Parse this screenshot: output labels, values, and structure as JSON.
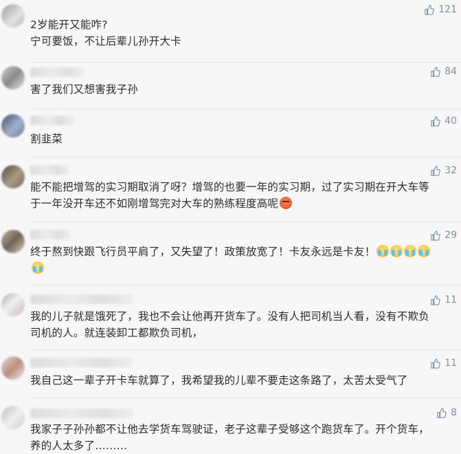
{
  "comments": [
    {
      "likes": "121",
      "lines": [
        "2岁能开又能咋?",
        "宁可要饭，不让后辈儿孙开大卡"
      ]
    },
    {
      "likes": "84",
      "lines": [
        "害了我们又想害我子孙"
      ]
    },
    {
      "likes": "40",
      "lines": [
        "割韭菜"
      ]
    },
    {
      "likes": "32",
      "lines": [
        "能不能把增驾的实习期取消了呀？增驾的也要一年的实习期，过了实习期在开大车等",
        "于一年没开车还不如刚增驾完对大车的熟练程度高呢"
      ],
      "emoji_after": "angry-face-icon"
    },
    {
      "likes": "29",
      "lines": [
        "终于熬到快跟飞行员平肩了，又失望了！政策放宽了！卡友永远是卡友！"
      ],
      "emoji_after": "crying-face-icon"
    },
    {
      "likes": "11",
      "lines": [
        "我的儿子就是饿死了，我也不会让他再开货车了。没有人把司机当人看，没有不欺负",
        "司机的人。就连装卸工都欺负司机，"
      ]
    },
    {
      "likes": "11",
      "lines": [
        "我自己这一辈子开卡车就算了，我希望我的儿辈不要走这条路了，太苦太受气了"
      ]
    },
    {
      "likes": "8",
      "lines": [
        "我家子子孙孙都不让他去学货车驾驶证，老子这辈子受够这个跑货车了。开个货车，",
        "养的人太多了………"
      ]
    }
  ],
  "icons": {
    "like": "thumbs-up-icon"
  },
  "colors": {
    "like": "#7a8fa8",
    "text": "#2b2b2b",
    "background": "#f7f7f7"
  }
}
